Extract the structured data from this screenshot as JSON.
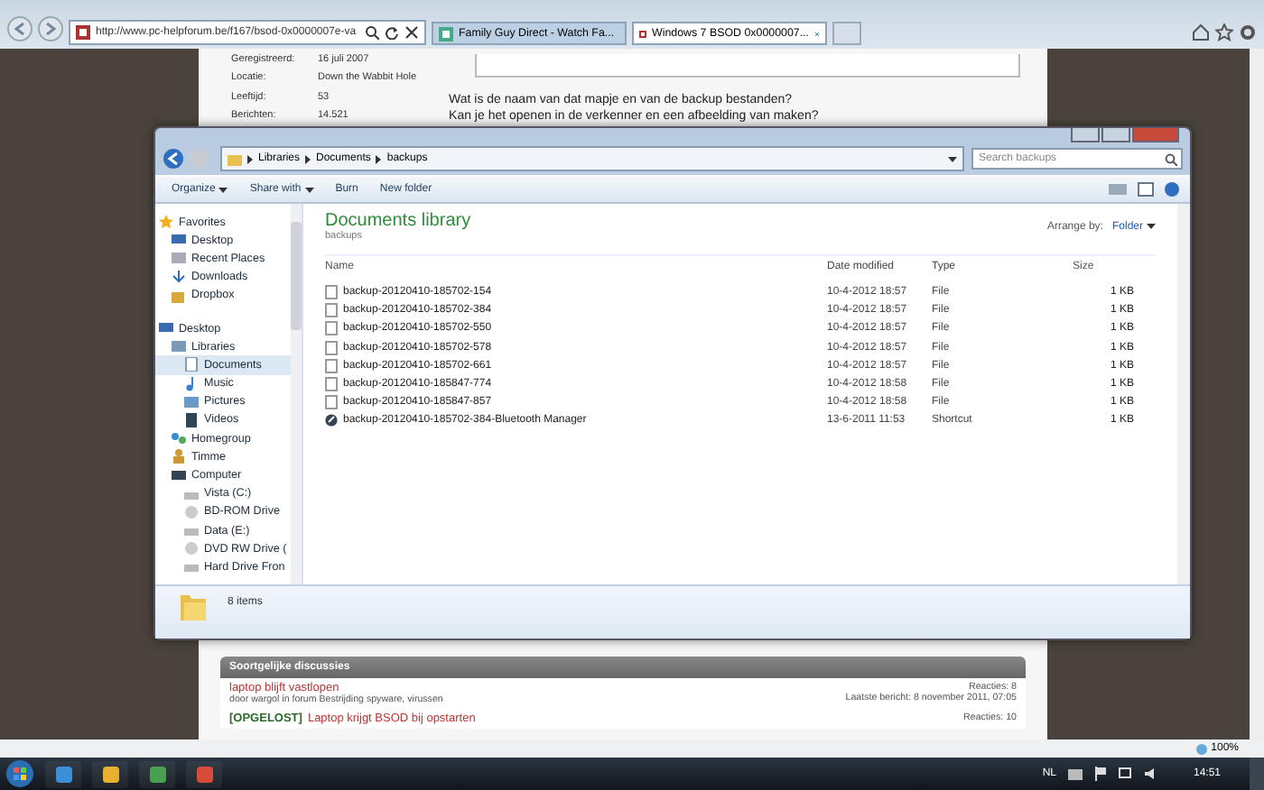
{
  "browser": {
    "address": "http://www.pc-helpforum.be/f167/bsod-0x0000007e-va",
    "tabs": [
      {
        "label": "Family Guy Direct - Watch Fa...",
        "selected": false
      },
      {
        "label": "Windows 7 BSOD 0x0000007...",
        "selected": true
      }
    ],
    "zoom": "100%"
  },
  "forum": {
    "profile": [
      {
        "label": "Geregistreerd:",
        "value": "16 juli 2007"
      },
      {
        "label": "Locatie:",
        "value": "Down the Wabbit Hole"
      },
      {
        "label": "Leeftijd:",
        "value": "53"
      },
      {
        "label": "Berichten:",
        "value": "14.521"
      }
    ],
    "post_lines": [
      "Wat is de naam van dat mapje en van de backup bestanden?",
      "Kan je het openen in de verkenner en een afbeelding van maken?"
    ],
    "similar": {
      "title": "Soortgelijke discussies",
      "items": [
        {
          "title": "laptop blijft vastlopen",
          "meta": "door wargol in forum Bestrijding spyware, virussen",
          "replies": "Reacties: 8",
          "last": "Laatste bericht: 8 november 2011, 07:05"
        },
        {
          "prefix": "[OPGELOST]",
          "title": "Laptop krijgt BSOD bij opstarten",
          "replies": "Reacties: 10"
        }
      ]
    }
  },
  "explorer": {
    "breadcrumb": [
      "Libraries",
      "Documents",
      "backups"
    ],
    "search": {
      "placeholder": "Search backups"
    },
    "toolbar": [
      {
        "label": "Organize",
        "dropdown": true
      },
      {
        "label": "Share with",
        "dropdown": true
      },
      {
        "label": "Burn",
        "dropdown": false
      },
      {
        "label": "New folder",
        "dropdown": false
      }
    ],
    "sidebar": [
      {
        "label": "Favorites",
        "selected": false,
        "children": [
          {
            "label": "Desktop",
            "selected": false
          },
          {
            "label": "Recent Places",
            "selected": false
          },
          {
            "label": "Downloads",
            "selected": false
          },
          {
            "label": "Dropbox",
            "selected": false
          }
        ]
      },
      {
        "label": "Desktop",
        "selected": false,
        "children": [
          {
            "label": "Libraries",
            "selected": false,
            "children": [
              {
                "label": "Documents",
                "selected": true
              },
              {
                "label": "Music",
                "selected": false
              },
              {
                "label": "Pictures",
                "selected": false
              },
              {
                "label": "Videos",
                "selected": false
              }
            ]
          },
          {
            "label": "Homegroup",
            "selected": false
          },
          {
            "label": "Timme",
            "selected": false
          },
          {
            "label": "Computer",
            "selected": false,
            "children": [
              {
                "label": "Vista (C:)",
                "selected": false
              },
              {
                "label": "BD-ROM Drive",
                "selected": false
              },
              {
                "label": "Data (E:)",
                "selected": false
              },
              {
                "label": "DVD RW Drive (",
                "selected": false
              },
              {
                "label": "Hard Drive Fron",
                "selected": false
              }
            ]
          }
        ]
      }
    ],
    "library_title": "Documents library",
    "library_sub": "backups",
    "arrange_label": "Arrange by:",
    "arrange_value": "Folder",
    "columns": [
      "Name",
      "Date modified",
      "Type",
      "Size"
    ],
    "files": [
      {
        "kind": "file",
        "name": "backup-20120410-185702-154",
        "date": "10-4-2012 18:57",
        "type": "File",
        "size": "1 KB"
      },
      {
        "kind": "file",
        "name": "backup-20120410-185702-384",
        "date": "10-4-2012 18:57",
        "type": "File",
        "size": "1 KB"
      },
      {
        "kind": "file",
        "name": "backup-20120410-185702-550",
        "date": "10-4-2012 18:57",
        "type": "File",
        "size": "1 KB"
      },
      {
        "kind": "file",
        "name": "backup-20120410-185702-578",
        "date": "10-4-2012 18:57",
        "type": "File",
        "size": "1 KB"
      },
      {
        "kind": "file",
        "name": "backup-20120410-185702-661",
        "date": "10-4-2012 18:57",
        "type": "File",
        "size": "1 KB"
      },
      {
        "kind": "file",
        "name": "backup-20120410-185847-774",
        "date": "10-4-2012 18:58",
        "type": "File",
        "size": "1 KB"
      },
      {
        "kind": "file",
        "name": "backup-20120410-185847-857",
        "date": "10-4-2012 18:58",
        "type": "File",
        "size": "1 KB"
      },
      {
        "kind": "shortcut",
        "name": "backup-20120410-185702-384-Bluetooth Manager",
        "date": "13-6-2011 11:53",
        "type": "Shortcut",
        "size": "1 KB"
      }
    ],
    "status": "8 items"
  },
  "taskbar": {
    "language": "NL",
    "clock": "14:51"
  }
}
